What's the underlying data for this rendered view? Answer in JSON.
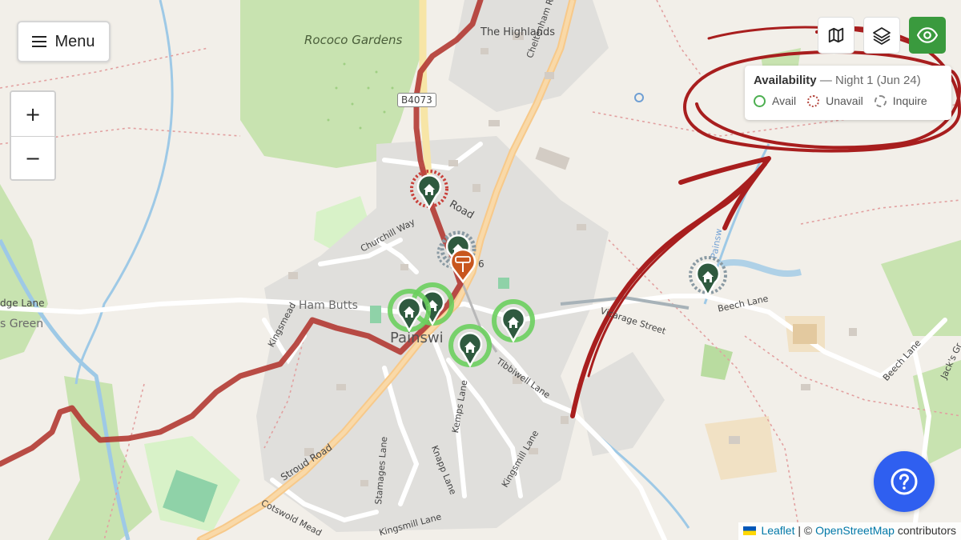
{
  "menu": {
    "label": "Menu"
  },
  "zoom": {
    "in_label": "+",
    "out_label": "−"
  },
  "toolbar": {
    "buttons": [
      "map-icon",
      "layers-icon",
      "eye-icon"
    ],
    "active_color": "#3a9a3e"
  },
  "legend": {
    "title": "Availability",
    "subtitle": "— Night 1 (Jun 24)",
    "items": [
      {
        "label": "Avail",
        "color": "#4caf50",
        "style": "solid"
      },
      {
        "label": "Unavail",
        "color": "#b5483f",
        "style": "dotted"
      },
      {
        "label": "Inquire",
        "color": "#8a8a8a",
        "style": "dashed"
      }
    ]
  },
  "map_labels": {
    "rococo": "Rococo Gardens",
    "highlands": "The Highlands",
    "cheltenham_road": "Cheltenham Road",
    "shield": "B4073",
    "road_fragment": "Road",
    "churchill_way": "Churchill Way",
    "ham_butts": "Ham Butts",
    "painswick": "Painswi",
    "kingsmead": "Kingsmead",
    "edge_lane": "dge Lane",
    "s_green": "s Green",
    "vicarage_street": "Vicarage Street",
    "beech_lane": "Beech Lane",
    "beech_lane2": "Beech Lane",
    "jacks": "Jack's Gr",
    "tibbiwell": "Tibbiwell Lane",
    "kemps": "Kemps Lane",
    "knapp": "Knapp Lane",
    "kingsmill": "Kingsmill Lane",
    "stroud_road": "Stroud Road",
    "stamages": "Stamages Lane",
    "cotswold": "Cotswold Mead",
    "kingsmill2": "Kingsmill Lane",
    "painswick_stream": "Painsw",
    "num6": "6"
  },
  "markers": [
    {
      "name": "unavailable-house-marker",
      "status": "unavail",
      "icon": "house-icon"
    },
    {
      "name": "inquire-house-marker-1",
      "status": "inquire",
      "icon": "house-icon"
    },
    {
      "name": "available-house-marker-1",
      "status": "avail",
      "icon": "house-icon"
    },
    {
      "name": "available-house-marker-2",
      "status": "avail",
      "icon": "house-icon"
    },
    {
      "name": "available-house-marker-3",
      "status": "avail",
      "icon": "house-icon"
    },
    {
      "name": "available-house-marker-4",
      "status": "avail",
      "icon": "house-icon"
    },
    {
      "name": "inquire-house-marker-2",
      "status": "inquire",
      "icon": "house-icon"
    },
    {
      "name": "signpost-marker",
      "status": "poi",
      "icon": "signpost-icon"
    }
  ],
  "help": {
    "icon": "question-icon"
  },
  "attribution": {
    "leaflet": "Leaflet",
    "separator": "| ©",
    "osm": "OpenStreetMap",
    "suffix": "contributors"
  }
}
